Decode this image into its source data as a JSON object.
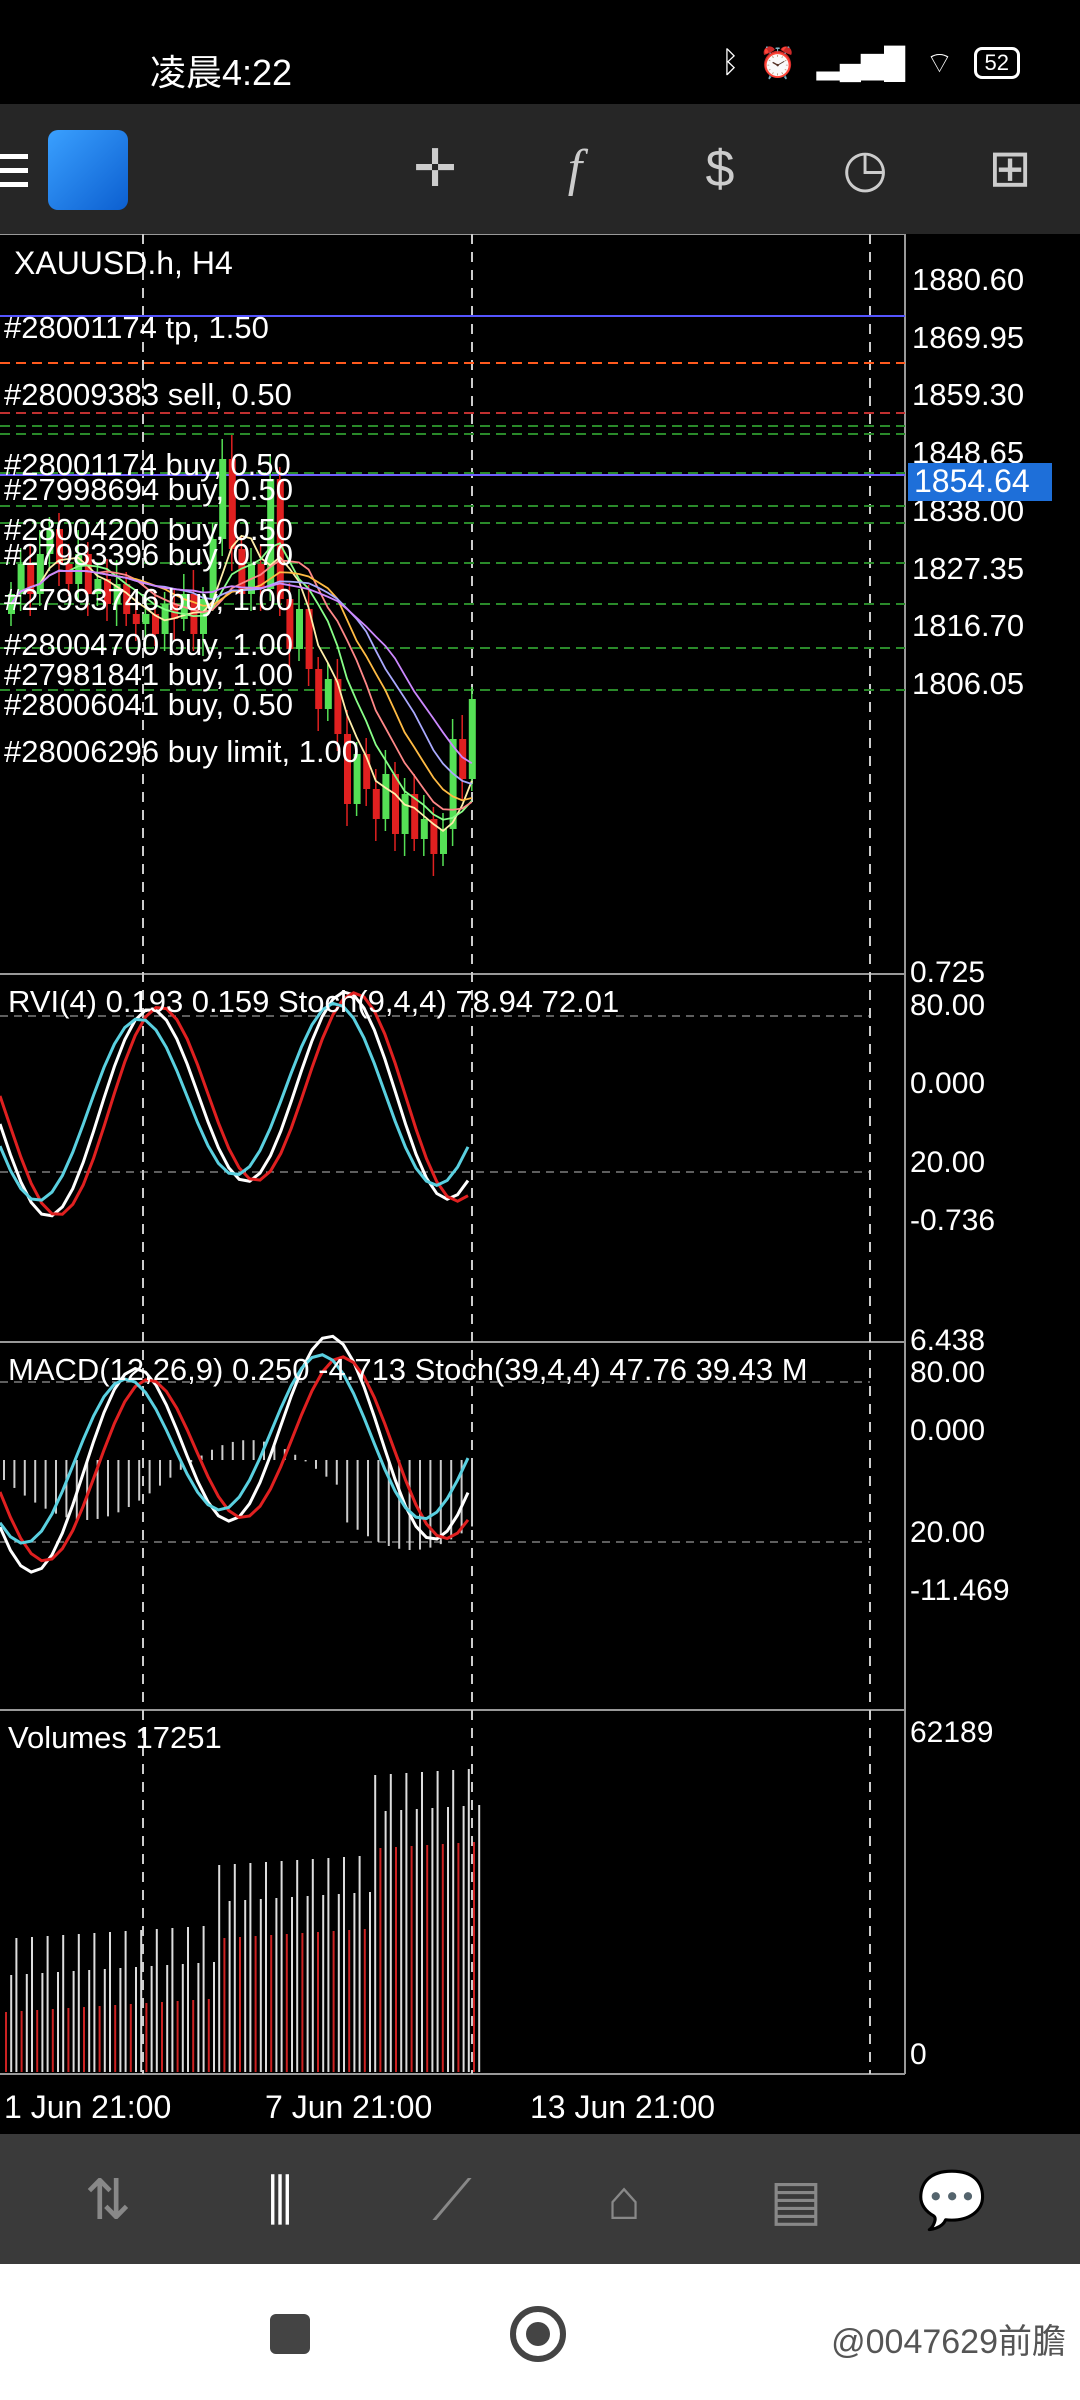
{
  "status": {
    "time": "凌晨4:22",
    "battery": "52"
  },
  "chart": {
    "title": "XAUUSD.h, H4",
    "price_ticks": [
      "1880.60",
      "1869.95",
      "1859.30",
      "1848.65",
      "1838.00",
      "1827.35",
      "1816.70",
      "1806.05"
    ],
    "current_price": "1854.64",
    "orders": [
      "#28001174 tp, 1.50",
      "#28009383 sell, 0.50",
      "#28001174 buy, 0.50",
      "#27998694 buy, 0.50",
      "#28004200 buy, 0.50",
      "#27983396 buy, 0.70",
      "#27993746 buy, 1.00",
      "#28004700 buy, 1.00",
      "#27981841 buy, 1.00",
      "#28006041 buy, 0.50",
      "#28006296 buy limit, 1.00"
    ],
    "rvi_label": "RVI(4) 0.193 0.159 Stoch(9,4,4) 78.94 72.01",
    "rvi_ticks": [
      "0.725",
      "80.00",
      "0.000",
      "20.00",
      "-0.736"
    ],
    "macd_label": "MACD(12,26,9) 0.250 -4.713 Stoch(39,4,4) 47.76 39.43 M",
    "macd_ticks": [
      "6.438",
      "80.00",
      "0.000",
      "20.00",
      "-11.469"
    ],
    "vol_label": "Volumes 17251",
    "vol_ticks": [
      "62189",
      "0"
    ],
    "time_labels": [
      "1 Jun 21:00",
      "7 Jun 21:00",
      "13 Jun 21:00"
    ]
  },
  "colors": {
    "up": "#55e055",
    "down": "#e02020",
    "accent": "#1e6fd9",
    "grid": "#888888"
  },
  "watermark": "@0047629前膽",
  "toolbar_icons": [
    "crosshair-icon",
    "function-icon",
    "trade-icon",
    "clock-icon",
    "new-order-icon"
  ],
  "nav_icons": [
    "quotes-icon",
    "chart-icon",
    "trade-icon",
    "history-icon",
    "news-icon",
    "chat-icon"
  ]
}
